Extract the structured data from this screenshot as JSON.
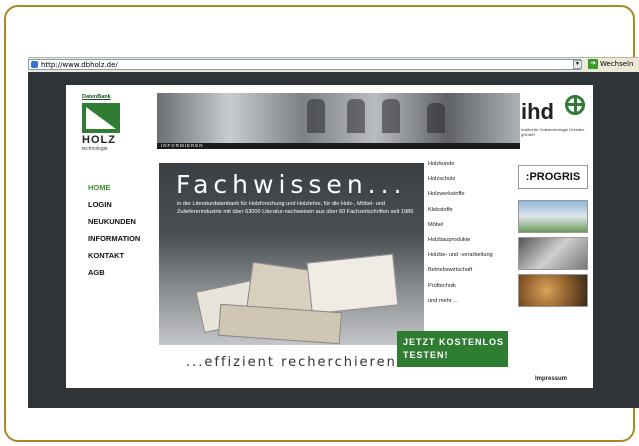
{
  "browser": {
    "url": "http://www.dbholz.de/",
    "go_label": "Wechseln"
  },
  "logo": {
    "datenbank": "DatenBank",
    "holz": "HOLZ",
    "technologie": "technologie"
  },
  "banner": {
    "strip_label": "INFORMIEREN"
  },
  "ihd": {
    "name": "ihd",
    "subtitle": "Institut für Holztechnologie Dresden gGmbH"
  },
  "nav": {
    "items": [
      "HOME",
      "LOGIN",
      "NEUKUNDEN",
      "INFORMATION",
      "KONTAKT",
      "AGB"
    ],
    "active_index": 0
  },
  "hero": {
    "title": "Fachwissen...",
    "text": "in der Literaturdatenbank für Holzforschung und Holzlehre, für die Holz-, Möbel- und Zuliefererindustrie mit über 63000 Literatur-nachweisen aus über 60 Fachzeitschriften seit 1986"
  },
  "tagline": "...effizient recherchieren",
  "cta": {
    "line1": "JETZT KOSTENLOS",
    "line2": "TESTEN!"
  },
  "topics": [
    "Holzkunde",
    "Holzschutz",
    "Holzwerkstoffe",
    "Klebstoffe",
    "Möbel",
    "Holzbauprodukte",
    "Holzbe- und -verarbeitung",
    "Betriebswirtschaft",
    "Prüftechnik",
    "und mehr ..."
  ],
  "partners": {
    "progris": ":PROGRIS"
  },
  "footer": {
    "impressum": "Impressum"
  },
  "colors": {
    "accent_green": "#2e7d32",
    "frame_gold": "#a88a20",
    "page_dark": "#2e3438"
  }
}
